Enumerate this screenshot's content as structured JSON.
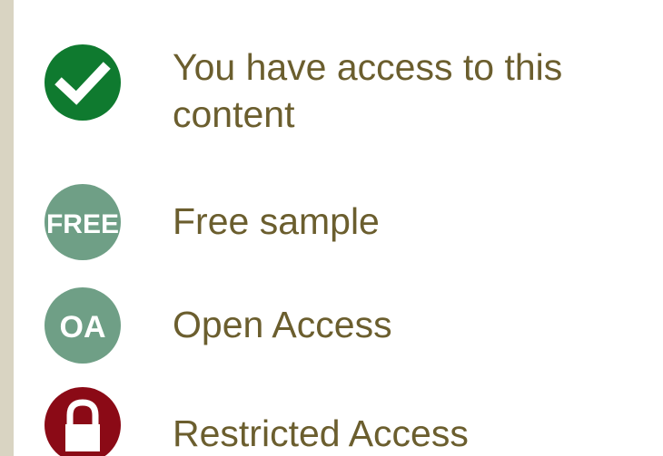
{
  "colors": {
    "label_text": "#6b5e2e",
    "access_green": "#0f7a2f",
    "free_green": "#6f9f86",
    "oa_green": "#6f9f86",
    "restricted_red": "#8b0a16",
    "border": "#d9d4c2"
  },
  "legend": {
    "items": [
      {
        "icon": "checkmark-icon",
        "label": "You have access to this content"
      },
      {
        "icon": "free-badge-icon",
        "badge_text": "FREE",
        "label": "Free sample"
      },
      {
        "icon": "open-access-icon",
        "badge_text": "OA",
        "label": "Open Access"
      },
      {
        "icon": "lock-icon",
        "label": "Restricted Access"
      }
    ]
  }
}
